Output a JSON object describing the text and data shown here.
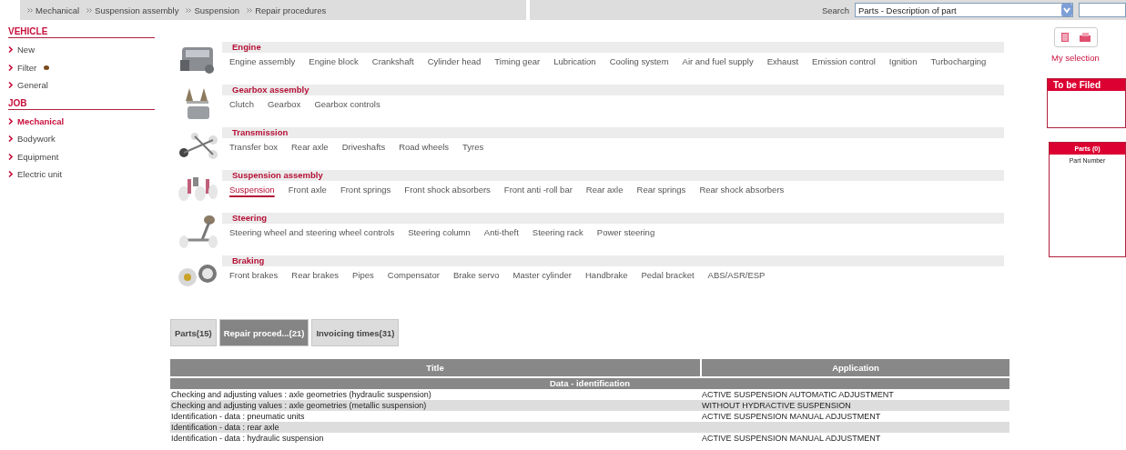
{
  "breadcrumb": [
    "Mechanical",
    "Suspension assembly",
    "Suspension",
    "Repair procedures"
  ],
  "search": {
    "label": "Search",
    "value": "Parts - Description of part"
  },
  "sidebar": [
    {
      "title": "VEHICLE",
      "items": [
        {
          "label": "New",
          "selected": false
        },
        {
          "label": "Filter",
          "selected": false,
          "dot": true
        },
        {
          "label": "General",
          "selected": false
        }
      ]
    },
    {
      "title": "JOB",
      "items": [
        {
          "label": "Mechanical",
          "selected": true
        },
        {
          "label": "Bodywork",
          "selected": false
        },
        {
          "label": "Equipment",
          "selected": false
        },
        {
          "label": "Electric unit",
          "selected": false
        }
      ]
    }
  ],
  "categories": [
    {
      "title": "Engine",
      "items": [
        {
          "label": "Engine assembly",
          "selected": false
        },
        {
          "label": "Engine block",
          "selected": false
        },
        {
          "label": "Crankshaft",
          "selected": false
        },
        {
          "label": "Cylinder head",
          "selected": false
        },
        {
          "label": "Timing gear",
          "selected": false
        },
        {
          "label": "Lubrication",
          "selected": false
        },
        {
          "label": "Cooling system",
          "selected": false
        },
        {
          "label": "Air and fuel supply",
          "selected": false
        },
        {
          "label": "Exhaust",
          "selected": false
        },
        {
          "label": "Emission control",
          "selected": false
        },
        {
          "label": "Ignition",
          "selected": false
        },
        {
          "label": "Turbocharging",
          "selected": false
        }
      ]
    },
    {
      "title": "Gearbox assembly",
      "items": [
        {
          "label": "Clutch",
          "selected": false
        },
        {
          "label": "Gearbox",
          "selected": false
        },
        {
          "label": "Gearbox controls",
          "selected": false
        }
      ]
    },
    {
      "title": "Transmission",
      "items": [
        {
          "label": "Transfer box",
          "selected": false
        },
        {
          "label": "Rear axle",
          "selected": false
        },
        {
          "label": "Driveshafts",
          "selected": false
        },
        {
          "label": "Road wheels",
          "selected": false
        },
        {
          "label": "Tyres",
          "selected": false
        }
      ]
    },
    {
      "title": "Suspension assembly",
      "items": [
        {
          "label": "Suspension",
          "selected": true
        },
        {
          "label": "Front axle",
          "selected": false
        },
        {
          "label": "Front springs",
          "selected": false
        },
        {
          "label": "Front shock absorbers",
          "selected": false
        },
        {
          "label": "Front anti -roll bar",
          "selected": false
        },
        {
          "label": "Rear axle",
          "selected": false
        },
        {
          "label": "Rear springs",
          "selected": false
        },
        {
          "label": "Rear shock absorbers",
          "selected": false
        }
      ]
    },
    {
      "title": "Steering",
      "items": [
        {
          "label": "Steering wheel and steering wheel controls",
          "selected": false
        },
        {
          "label": "Steering column",
          "selected": false
        },
        {
          "label": "Anti-theft",
          "selected": false
        },
        {
          "label": "Steering rack",
          "selected": false
        },
        {
          "label": "Power steering",
          "selected": false
        }
      ]
    },
    {
      "title": "Braking",
      "items": [
        {
          "label": "Front brakes",
          "selected": false
        },
        {
          "label": "Rear brakes",
          "selected": false
        },
        {
          "label": "Pipes",
          "selected": false
        },
        {
          "label": "Compensator",
          "selected": false
        },
        {
          "label": "Brake servo",
          "selected": false
        },
        {
          "label": "Master cylinder",
          "selected": false
        },
        {
          "label": "Handbrake",
          "selected": false
        },
        {
          "label": "Pedal bracket",
          "selected": false
        },
        {
          "label": "ABS/ASR/ESP",
          "selected": false
        }
      ]
    }
  ],
  "result_tabs": [
    {
      "label": "Parts(15)",
      "selected": false
    },
    {
      "label": "Repair proced...(21)",
      "selected": true
    },
    {
      "label": "Invoicing times(31)",
      "selected": false
    }
  ],
  "table": {
    "columns": [
      "Title",
      "Application"
    ],
    "rows": [
      {
        "kind": "group",
        "title": "Data - identification"
      },
      {
        "kind": "row",
        "title": "Checking and adjusting values : axle geometries (hydraulic suspension)",
        "application": "ACTIVE SUSPENSION AUTOMATIC ADJUSTMENT"
      },
      {
        "kind": "row",
        "title": "Checking and adjusting values : axle geometries (metallic suspension)",
        "application": "WITHOUT HYDRACTIVE SUSPENSION"
      },
      {
        "kind": "row",
        "title": "Identification - data : pneumatic units",
        "application": "ACTIVE SUSPENSION MANUAL ADJUSTMENT"
      },
      {
        "kind": "row",
        "title": "Identification - data : rear axle"
      },
      {
        "kind": "row",
        "title": "Identification - data : hydraulic suspension",
        "application": "ACTIVE SUSPENSION MANUAL ADJUSTMENT"
      }
    ]
  },
  "my_selection": "My selection",
  "to_be_filed": {
    "title": "To be Filed"
  },
  "parts_panel": {
    "title": "Parts (0)",
    "column": "Part Number"
  }
}
